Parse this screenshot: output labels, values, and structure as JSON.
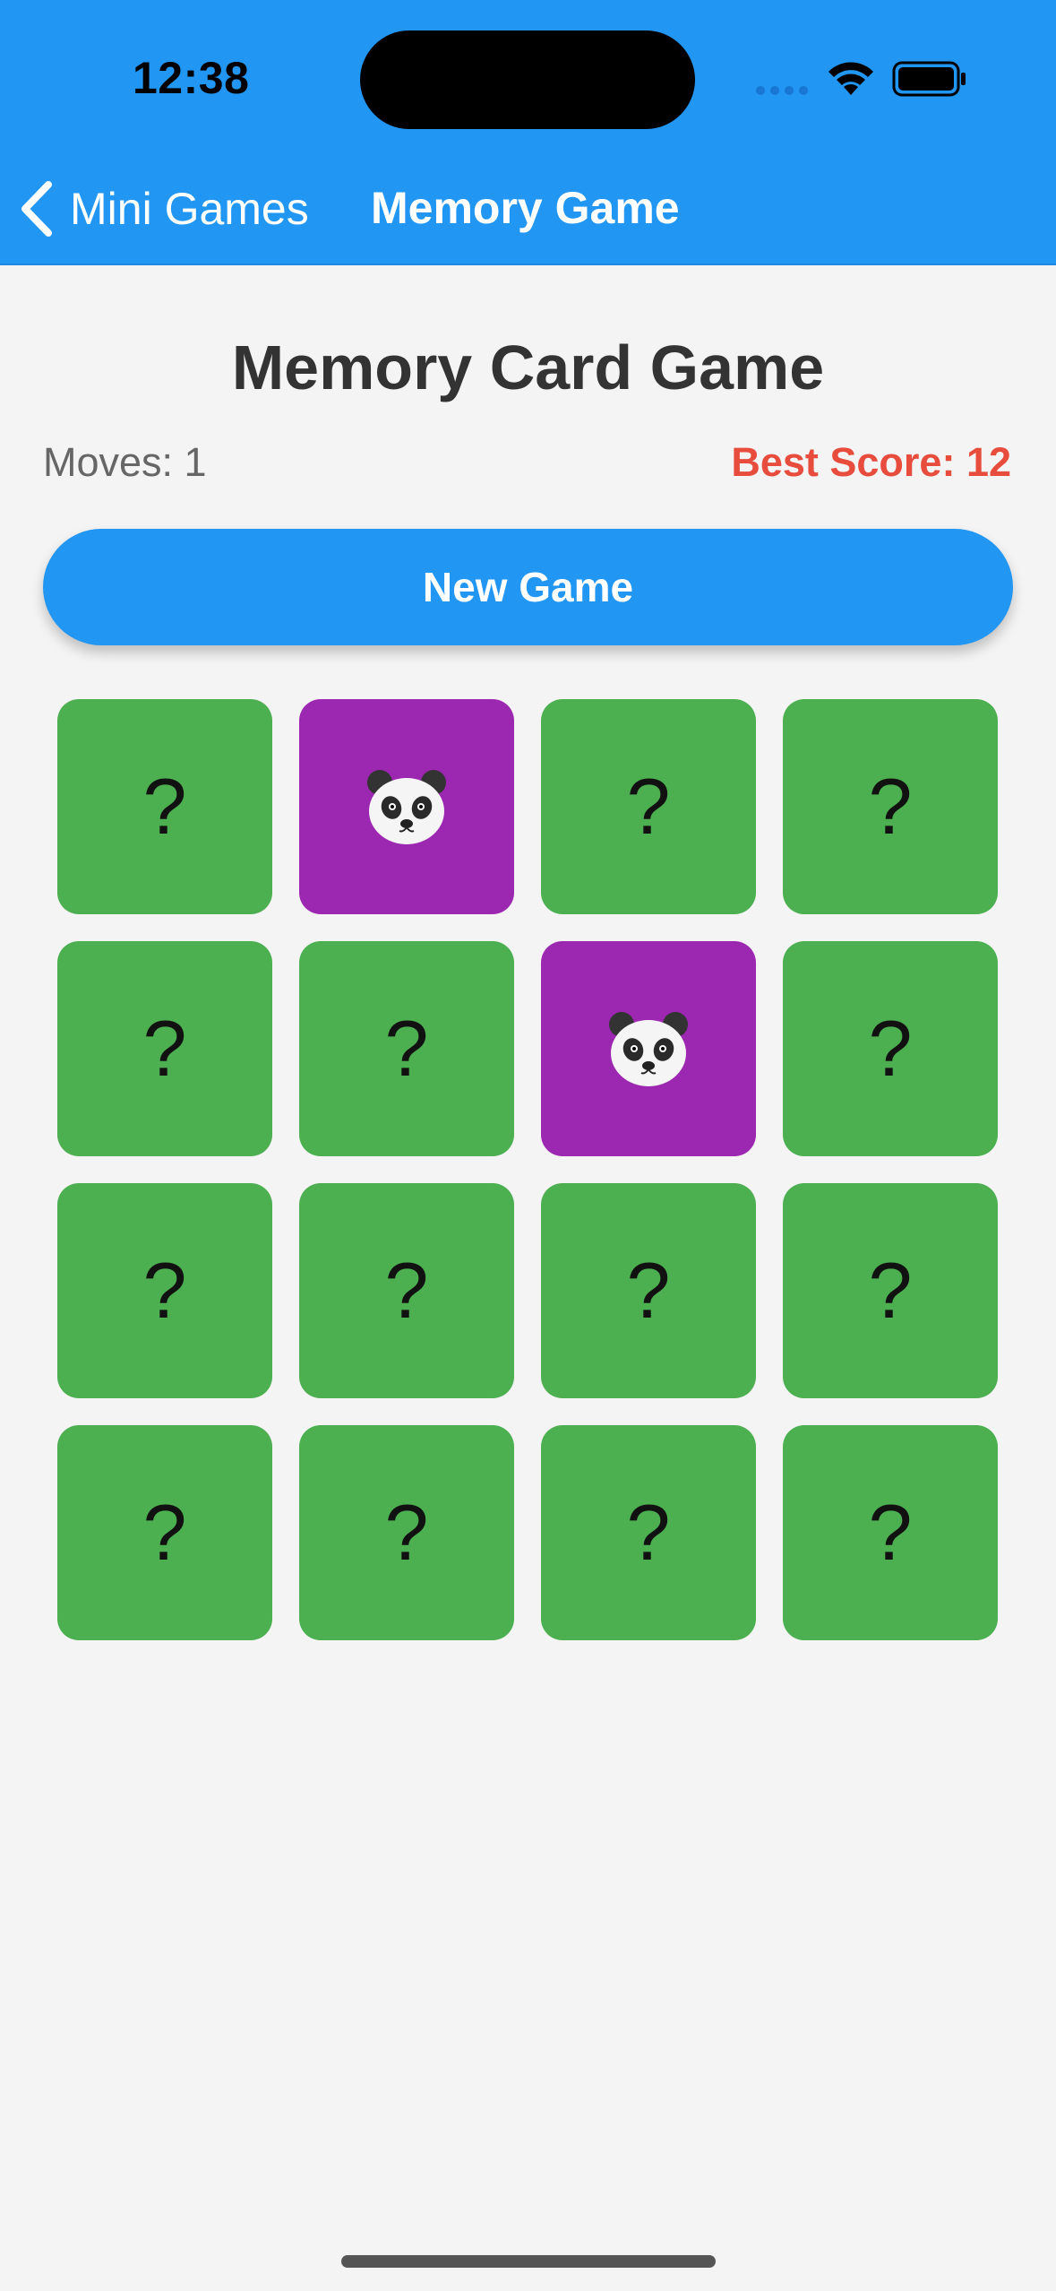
{
  "status_bar": {
    "time": "12:38",
    "icons": [
      "cellular-icon",
      "wifi-icon",
      "battery-icon"
    ]
  },
  "nav": {
    "back_label": "Mini Games",
    "title": "Memory Game"
  },
  "game": {
    "title": "Memory Card Game",
    "moves_label": "Moves: 1",
    "best_score_label": "Best Score: 12",
    "new_game_label": "New Game"
  },
  "cards": [
    {
      "state": "hidden",
      "face": "?"
    },
    {
      "state": "revealed",
      "face": "panda"
    },
    {
      "state": "hidden",
      "face": "?"
    },
    {
      "state": "hidden",
      "face": "?"
    },
    {
      "state": "hidden",
      "face": "?"
    },
    {
      "state": "hidden",
      "face": "?"
    },
    {
      "state": "revealed",
      "face": "panda"
    },
    {
      "state": "hidden",
      "face": "?"
    },
    {
      "state": "hidden",
      "face": "?"
    },
    {
      "state": "hidden",
      "face": "?"
    },
    {
      "state": "hidden",
      "face": "?"
    },
    {
      "state": "hidden",
      "face": "?"
    },
    {
      "state": "hidden",
      "face": "?"
    },
    {
      "state": "hidden",
      "face": "?"
    },
    {
      "state": "hidden",
      "face": "?"
    },
    {
      "state": "hidden",
      "face": "?"
    }
  ],
  "colors": {
    "header": "#2196f3",
    "card_hidden": "#4caf50",
    "card_revealed": "#9c27b0",
    "best_score": "#e74c3c",
    "button": "#2196f3"
  }
}
